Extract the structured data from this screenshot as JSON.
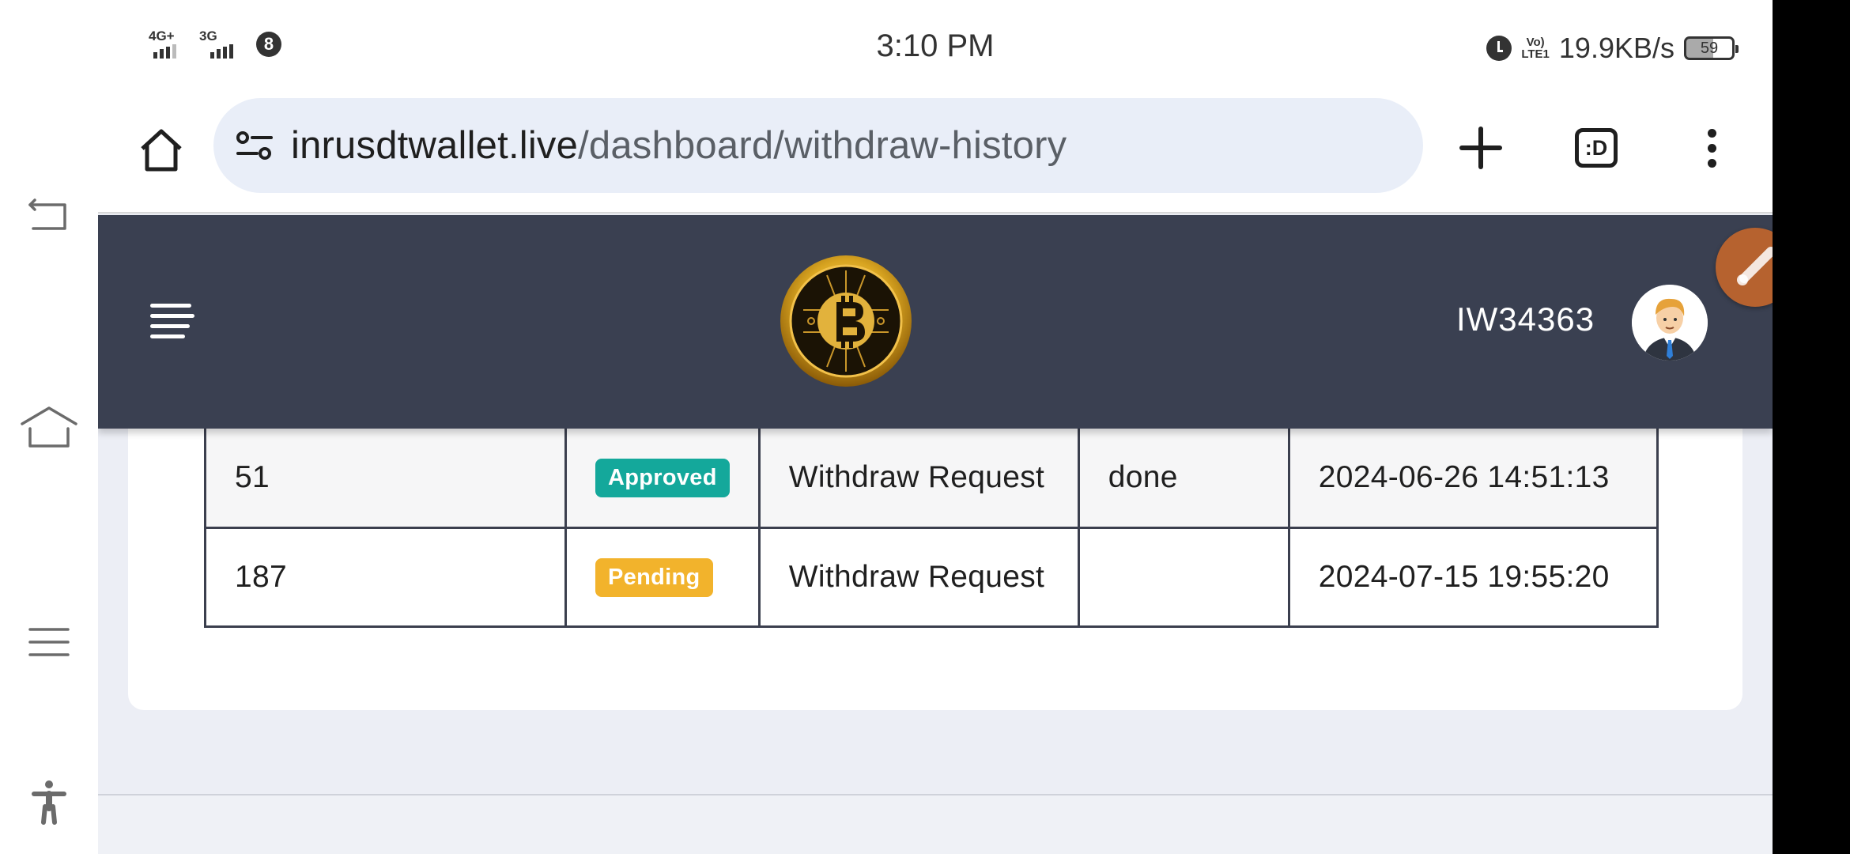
{
  "status_bar": {
    "signal_1": "4G+",
    "signal_2": "3G",
    "notification_count": "8",
    "time": "3:10 PM",
    "volte": "Vo) LTE1",
    "net_speed": "19.9KB/s",
    "battery": "59"
  },
  "browser": {
    "url_domain": "inrusdtwallet.live",
    "url_path": "/dashboard/withdraw-history",
    "tabs_label": ":D"
  },
  "header": {
    "user_id": "IW34363"
  },
  "table": {
    "rows": [
      {
        "amount": "51",
        "status": "Approved",
        "type": "Withdraw Request",
        "remark": "done",
        "date": "2024-06-26 14:51:13"
      },
      {
        "amount": "187",
        "status": "Pending",
        "type": "Withdraw Request",
        "remark": "",
        "date": "2024-07-15 19:55:20"
      }
    ]
  },
  "colors": {
    "header_bg": "#3a4051",
    "approved": "#14a89b",
    "pending": "#f2b32c"
  }
}
